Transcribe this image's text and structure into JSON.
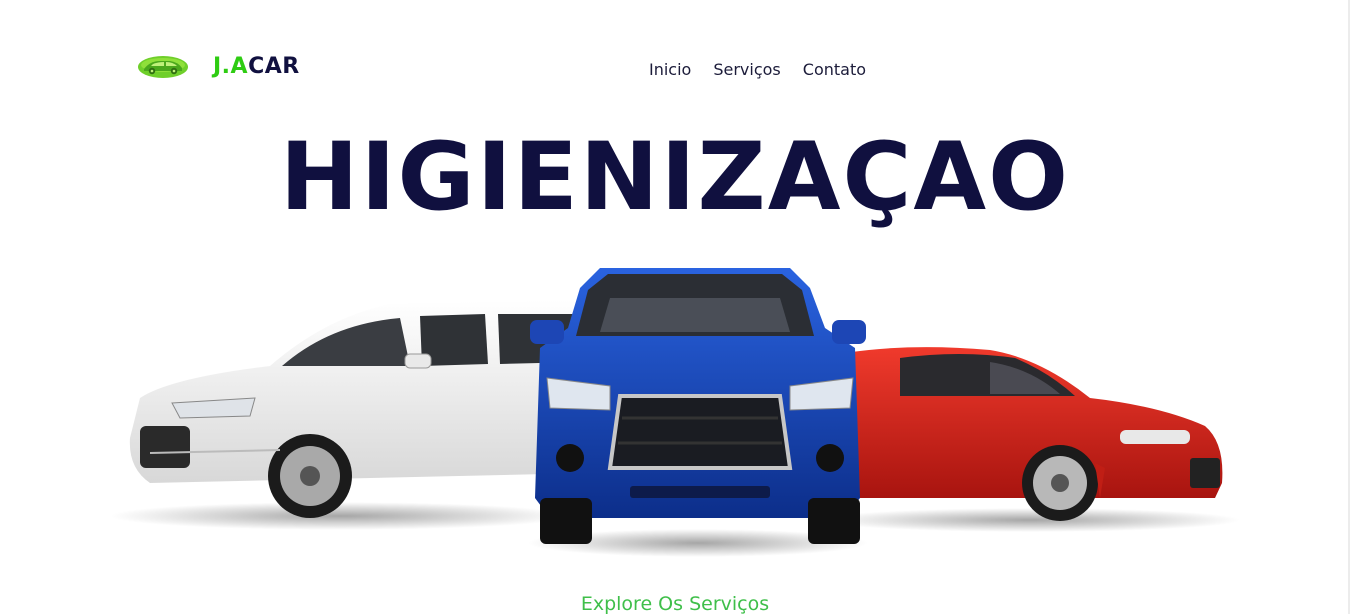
{
  "header": {
    "brand_prefix": "J.A",
    "brand_suffix": "CAR",
    "logo_icon": "leaf-car-icon"
  },
  "nav": {
    "items": [
      {
        "label": "Inicio"
      },
      {
        "label": "Serviços"
      },
      {
        "label": "Contato"
      }
    ]
  },
  "hero": {
    "title": "HIGIENIZAÇAO",
    "image": "three-cars-illustration",
    "cars": [
      "white-suv",
      "blue-suv",
      "red-sedan"
    ],
    "cta_label": "Explore Os Serviços"
  },
  "colors": {
    "accent_green": "#2ecc12",
    "navy": "#10103f",
    "cta_green": "#3fbf4a",
    "car_white": "#f2f2f2",
    "car_blue": "#1446b8",
    "car_red": "#d9231c"
  }
}
